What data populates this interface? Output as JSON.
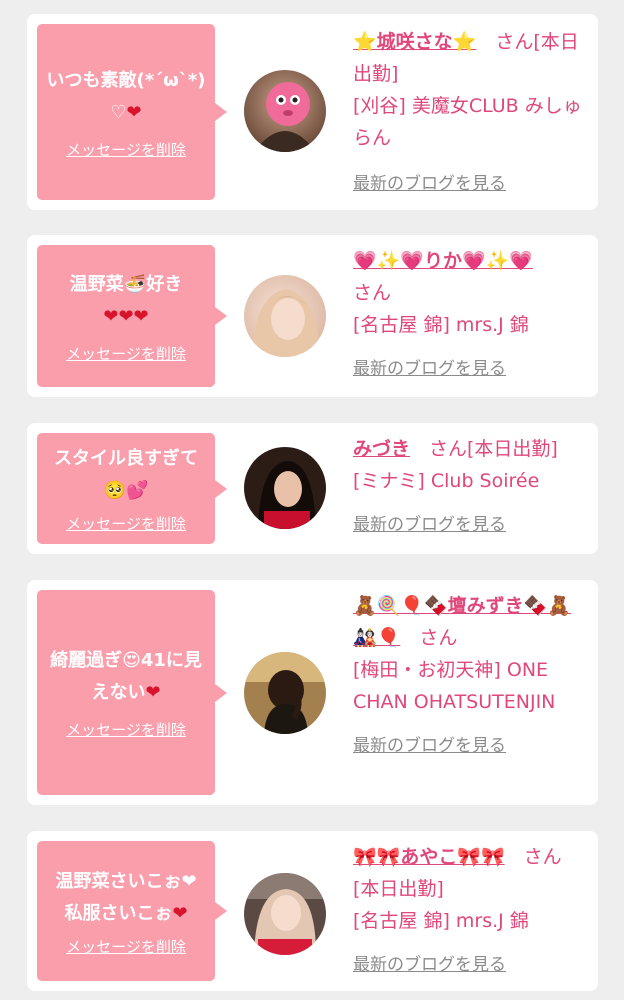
{
  "cards": [
    {
      "message": "いつも素敵(*´ω`*)♡",
      "message_heart": "❤",
      "delete_label": "メッセージを削除",
      "name": "⭐城咲さな⭐",
      "suffix": "さん[本日出勤]",
      "shop": "[刈谷] 美魔女CLUB みしゅらん",
      "blog_label": "最新のブログを見る"
    },
    {
      "message": "温野菜🍜好き",
      "message_heart": "❤❤❤",
      "delete_label": "メッセージを削除",
      "name": "💗✨💗りか💗✨💗",
      "suffix": "さん",
      "shop": "[名古屋 錦] mrs.J 錦",
      "blog_label": "最新のブログを見る"
    },
    {
      "message": "スタイル良すぎて🥺💕",
      "message_heart": "",
      "delete_label": "メッセージを削除",
      "name": "みづき",
      "suffix": "さん[本日出勤]",
      "shop": "[ミナミ] Club Soirée",
      "blog_label": "最新のブログを見る"
    },
    {
      "message": "綺麗過ぎ😍41に見えない",
      "message_heart": "❤",
      "delete_label": "メッセージを削除",
      "name": "🧸🍭🎈🍫壇みずき🍫🧸🎎🎈",
      "suffix": "さん",
      "shop": "[梅田・お初天神] ONE CHAN OHATSUTENJIN",
      "blog_label": "最新のブログを見る"
    },
    {
      "message": "温野菜さいこぉ❤ 私服さいこぉ",
      "message_heart": "❤",
      "delete_label": "メッセージを削除",
      "name": "🎀🎀あやこ🎀🎀",
      "suffix": "さん[本日出勤]",
      "shop": "[名古屋 錦] mrs.J 錦",
      "blog_label": "最新のブログを見る"
    }
  ],
  "colors": {
    "bubble": "#fa9eac",
    "name": "#e0477a",
    "blog_link": "#8b8b8b",
    "background": "#eeeeee"
  }
}
